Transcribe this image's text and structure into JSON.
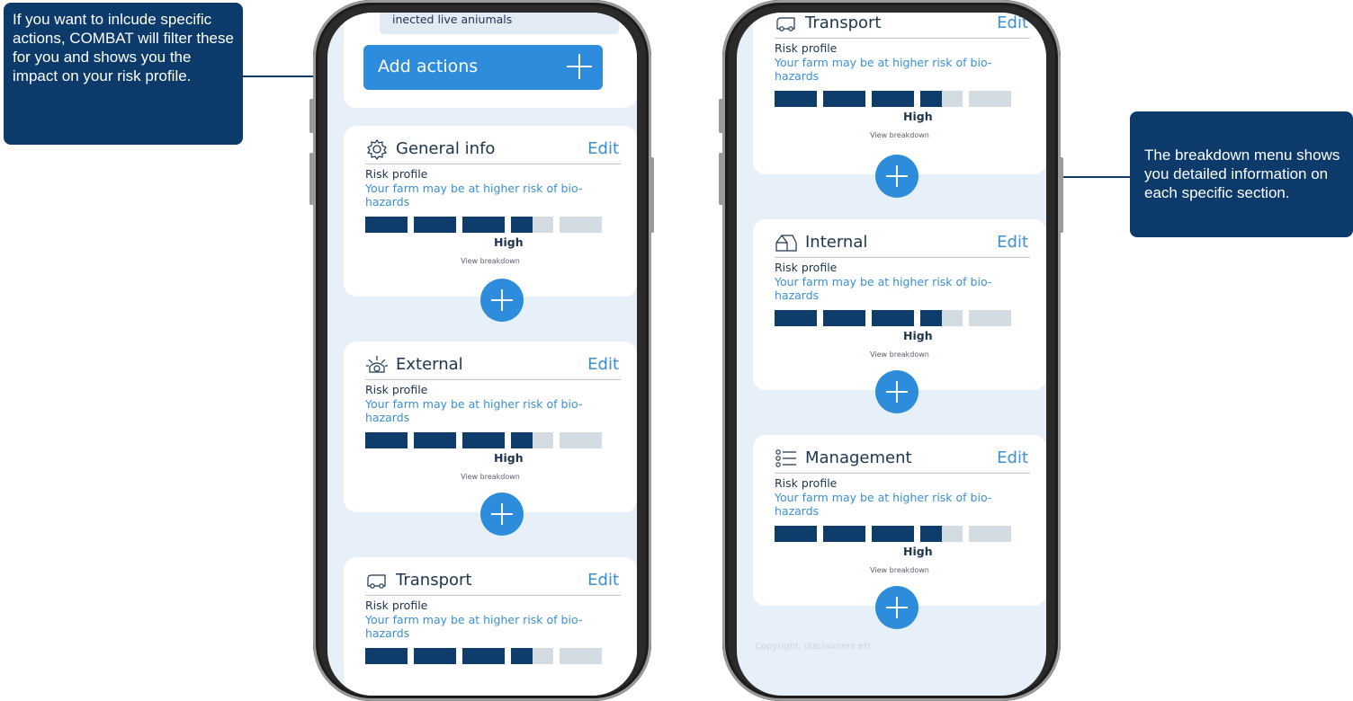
{
  "callouts": {
    "left": "If you want to inlcude specific actions, COMBAT will filter these for you and shows you the impact on your risk profile.",
    "right": "The breakdown menu shows you detailed information on each specific section."
  },
  "colors": {
    "accent": "#2d8ddc",
    "navy": "#0b3a6b",
    "bar_dark": "#0f3d6b",
    "bar_light": "#d3dbe3",
    "screen_bg": "#e7f0f8"
  },
  "common": {
    "edit": "Edit",
    "risk_label": "Risk profile",
    "risk_text": "Your farm may be at higher risk of bio-hazards",
    "risk_level": "High",
    "view_breakdown": "View breakdown"
  },
  "phone_left": {
    "top_field": "inected live aniumals",
    "add_actions": "Add actions",
    "sections": [
      {
        "title": "General info",
        "icon": "gear-icon"
      },
      {
        "title": "External",
        "icon": "sunset-icon"
      },
      {
        "title": "Transport",
        "icon": "truck-icon"
      }
    ]
  },
  "phone_right": {
    "sections": [
      {
        "title": "Transport",
        "icon": "truck-icon"
      },
      {
        "title": "Internal",
        "icon": "barn-icon"
      },
      {
        "title": "Management",
        "icon": "list-icon"
      }
    ],
    "copyright": "Copyright, disclaimers etc"
  }
}
